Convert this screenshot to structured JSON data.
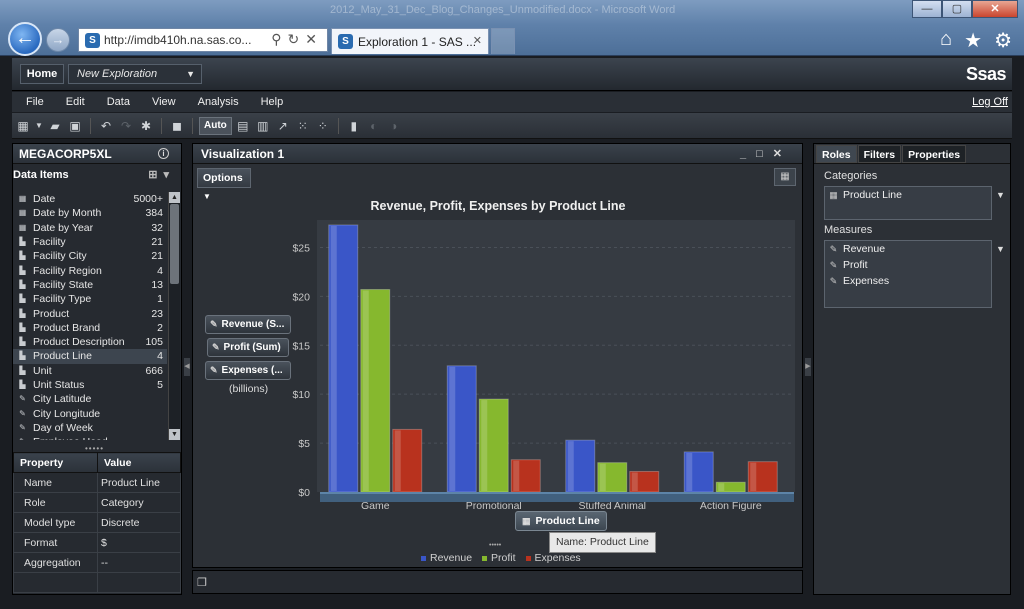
{
  "browser": {
    "window_title_ghost": "2012_May_31_Dec_Blog_Changes_Unmodified.docx - Microsoft Word",
    "address": "http://imdb410h.na.sas.co...",
    "tab_title": "Exploration 1 - SAS ...",
    "back_label": "←",
    "forward_label": "→"
  },
  "app": {
    "home_label": "Home",
    "exploration_select": "New Exploration",
    "logo": "Ssas",
    "menu": [
      "File",
      "Edit",
      "Data",
      "View",
      "Analysis",
      "Help"
    ],
    "logoff": "Log Off",
    "toolbar_auto": "Auto"
  },
  "left_panel": {
    "data_source": "MEGACORP5XL",
    "data_items_title": "Data Items",
    "items": [
      {
        "label": "Date",
        "count": "5000+",
        "icon": "calendar-icon"
      },
      {
        "label": "Date by Month",
        "count": "384",
        "icon": "calendar-icon"
      },
      {
        "label": "Date by Year",
        "count": "32",
        "icon": "calendar-icon"
      },
      {
        "label": "Facility",
        "count": "21",
        "icon": "category-icon"
      },
      {
        "label": "Facility City",
        "count": "21",
        "icon": "category-icon"
      },
      {
        "label": "Facility Region",
        "count": "4",
        "icon": "category-icon"
      },
      {
        "label": "Facility State",
        "count": "13",
        "icon": "category-icon"
      },
      {
        "label": "Facility Type",
        "count": "1",
        "icon": "category-icon"
      },
      {
        "label": "Product",
        "count": "23",
        "icon": "category-icon"
      },
      {
        "label": "Product Brand",
        "count": "2",
        "icon": "category-icon"
      },
      {
        "label": "Product Description",
        "count": "105",
        "icon": "category-icon"
      },
      {
        "label": "Product Line",
        "count": "4",
        "icon": "category-icon"
      },
      {
        "label": "Unit",
        "count": "666",
        "icon": "category-icon"
      },
      {
        "label": "Unit Status",
        "count": "5",
        "icon": "category-icon"
      },
      {
        "label": "City Latitude",
        "count": "",
        "icon": "measure-icon"
      },
      {
        "label": "City Longitude",
        "count": "",
        "icon": "measure-icon"
      },
      {
        "label": "Day of Week",
        "count": "",
        "icon": "measure-icon"
      },
      {
        "label": "Employee Head...",
        "count": "",
        "icon": "measure-icon"
      }
    ],
    "selected_item_index": 11,
    "grip": "•••••",
    "properties": {
      "col_property": "Property",
      "col_value": "Value",
      "rows": [
        {
          "property": "Name",
          "value": "Product Line"
        },
        {
          "property": "Role",
          "value": "Category"
        },
        {
          "property": "Model type",
          "value": "Discrete"
        },
        {
          "property": "Format",
          "value": "$"
        },
        {
          "property": "Aggregation",
          "value": "--"
        },
        {
          "property": "",
          "value": ""
        }
      ]
    }
  },
  "visualization": {
    "title": "Visualization 1",
    "options_label": "Options",
    "measure_pills": [
      "Revenue (S...",
      "Profit (Sum)",
      "Expenses (..."
    ],
    "units_label": "(billions)",
    "category_pill": "Product Line",
    "tooltip": "Name: Product Line",
    "grip": "•••••"
  },
  "chart_data": {
    "type": "bar",
    "title": "Revenue, Profit, Expenses by Product Line",
    "xlabel": "Product Line",
    "ylabel": "",
    "categories": [
      "Game",
      "Promotional",
      "Stuffed Animal",
      "Action Figure"
    ],
    "series": [
      {
        "name": "Revenue",
        "values": [
          27.3,
          12.9,
          5.3,
          4.1
        ],
        "color": "#3a56c8"
      },
      {
        "name": "Profit",
        "values": [
          20.7,
          9.5,
          3.0,
          1.0
        ],
        "color": "#86b82e"
      },
      {
        "name": "Expenses",
        "values": [
          6.4,
          3.3,
          2.1,
          3.1
        ],
        "color": "#b8321e"
      }
    ],
    "ylim": [
      0,
      27.5
    ],
    "yticks": [
      "$0",
      "$5",
      "$10",
      "$15",
      "$20",
      "$25"
    ],
    "ytick_values": [
      0,
      5,
      10,
      15,
      20,
      25
    ],
    "grid": true,
    "legend_position": "bottom"
  },
  "right_panel": {
    "tabs": [
      "Roles",
      "Filters",
      "Properties"
    ],
    "active_tab": "Roles",
    "categories_label": "Categories",
    "categories": [
      "Product Line"
    ],
    "measures_label": "Measures",
    "measures": [
      "Revenue",
      "Profit",
      "Expenses"
    ]
  }
}
